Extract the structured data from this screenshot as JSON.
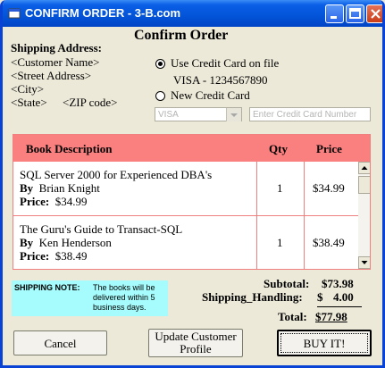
{
  "window": {
    "title": "CONFIRM ORDER - 3-B.com"
  },
  "heading": "Confirm Order",
  "shipping": {
    "label": "Shipping Address:",
    "name": "<Customer Name>",
    "street": "<Street Address>",
    "city": "<City>",
    "state": "<State>",
    "zip": "<ZIP code>"
  },
  "payment": {
    "use_on_file_label": "Use Credit Card on file",
    "card_on_file": "VISA - 1234567890",
    "new_card_label": "New Credit Card",
    "selected": "Use Credit Card on file",
    "card_type_value": "VISA",
    "card_number_placeholder": "Enter Credit Card Number"
  },
  "grid": {
    "headers": [
      "Book Description",
      "Qty",
      "Price"
    ],
    "rows": [
      {
        "title": "SQL Server 2000 for Experienced DBA's",
        "by_label": "By",
        "author": "Brian Knight",
        "price_label": "Price:",
        "price": "$34.99",
        "qty": "1",
        "line_price": "$34.99"
      },
      {
        "title": "The Guru's Guide to Transact-SQL",
        "by_label": "By",
        "author": "Ken Henderson",
        "price_label": "Price:",
        "price": "$38.49",
        "qty": "1",
        "line_price": "$38.49"
      }
    ]
  },
  "note": {
    "label": "SHIPPING NOTE:",
    "text": "The books will be delivered within 5 business days."
  },
  "totals": {
    "subtotal_label": "Subtotal:",
    "subtotal": "$73.98",
    "shipping_label": "Shipping_Handling:",
    "shipping_currency": "$",
    "shipping": "4.00",
    "total_label": "Total:",
    "total": "$77.98"
  },
  "buttons": {
    "cancel": "Cancel",
    "update_line1": "Update Customer",
    "update_line2": "Profile",
    "buy": "BUY IT!"
  },
  "colors": {
    "titlebar": "#0a5fe6",
    "grid_header": "#fa8080",
    "grid_border": "#f08080",
    "note_bg": "#a6fcfc",
    "window_bg": "#ece9d8"
  }
}
